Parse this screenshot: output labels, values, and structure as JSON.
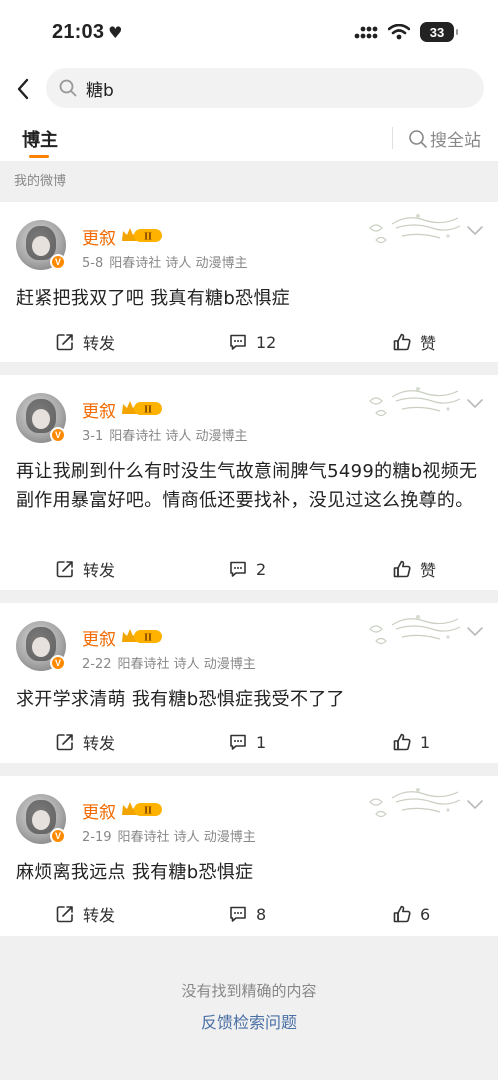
{
  "status_bar": {
    "time": "21:03",
    "battery": "33"
  },
  "search": {
    "query": "糖b"
  },
  "tabs": {
    "bloggers": "博主",
    "search_all": "搜全站"
  },
  "section_label": "我的微博",
  "posts": [
    {
      "author": "更叙",
      "level": "II",
      "date": "5-8",
      "tags": "阳春诗社 诗人 动漫博主",
      "text": "赶紧把我双了吧 我真有糖b恐惧症",
      "repost_label": "转发",
      "comment_count": "12",
      "like_label": "赞"
    },
    {
      "author": "更叙",
      "level": "II",
      "date": "3-1",
      "tags": "阳春诗社 诗人 动漫博主",
      "text": "再让我刷到什么有时没生气故意闹脾气5499的糖b视频无副作用暴富好吧。情商低还要找补，没见过这么挽尊的。",
      "repost_label": "转发",
      "comment_count": "2",
      "like_label": "赞"
    },
    {
      "author": "更叙",
      "level": "II",
      "date": "2-22",
      "tags": "阳春诗社 诗人 动漫博主",
      "text": "求开学求清萌 我有糖b恐惧症我受不了了",
      "repost_label": "转发",
      "comment_count": "1",
      "like_label": "1"
    },
    {
      "author": "更叙",
      "level": "II",
      "date": "2-19",
      "tags": "阳春诗社 诗人 动漫博主",
      "text": "麻烦离我远点 我有糖b恐惧症",
      "repost_label": "转发",
      "comment_count": "8",
      "like_label": "6"
    }
  ],
  "footer": {
    "not_found": "没有找到精确的内容",
    "feedback": "反馈检索问题"
  },
  "colors": {
    "accent": "#ff8200",
    "name": "#f26a00",
    "link": "#4a6fa5"
  },
  "icons": [
    "back-arrow-icon",
    "search-icon",
    "repost-icon",
    "comment-icon",
    "like-icon",
    "chevron-down-icon",
    "verified-badge-icon",
    "level-crown-icon"
  ]
}
